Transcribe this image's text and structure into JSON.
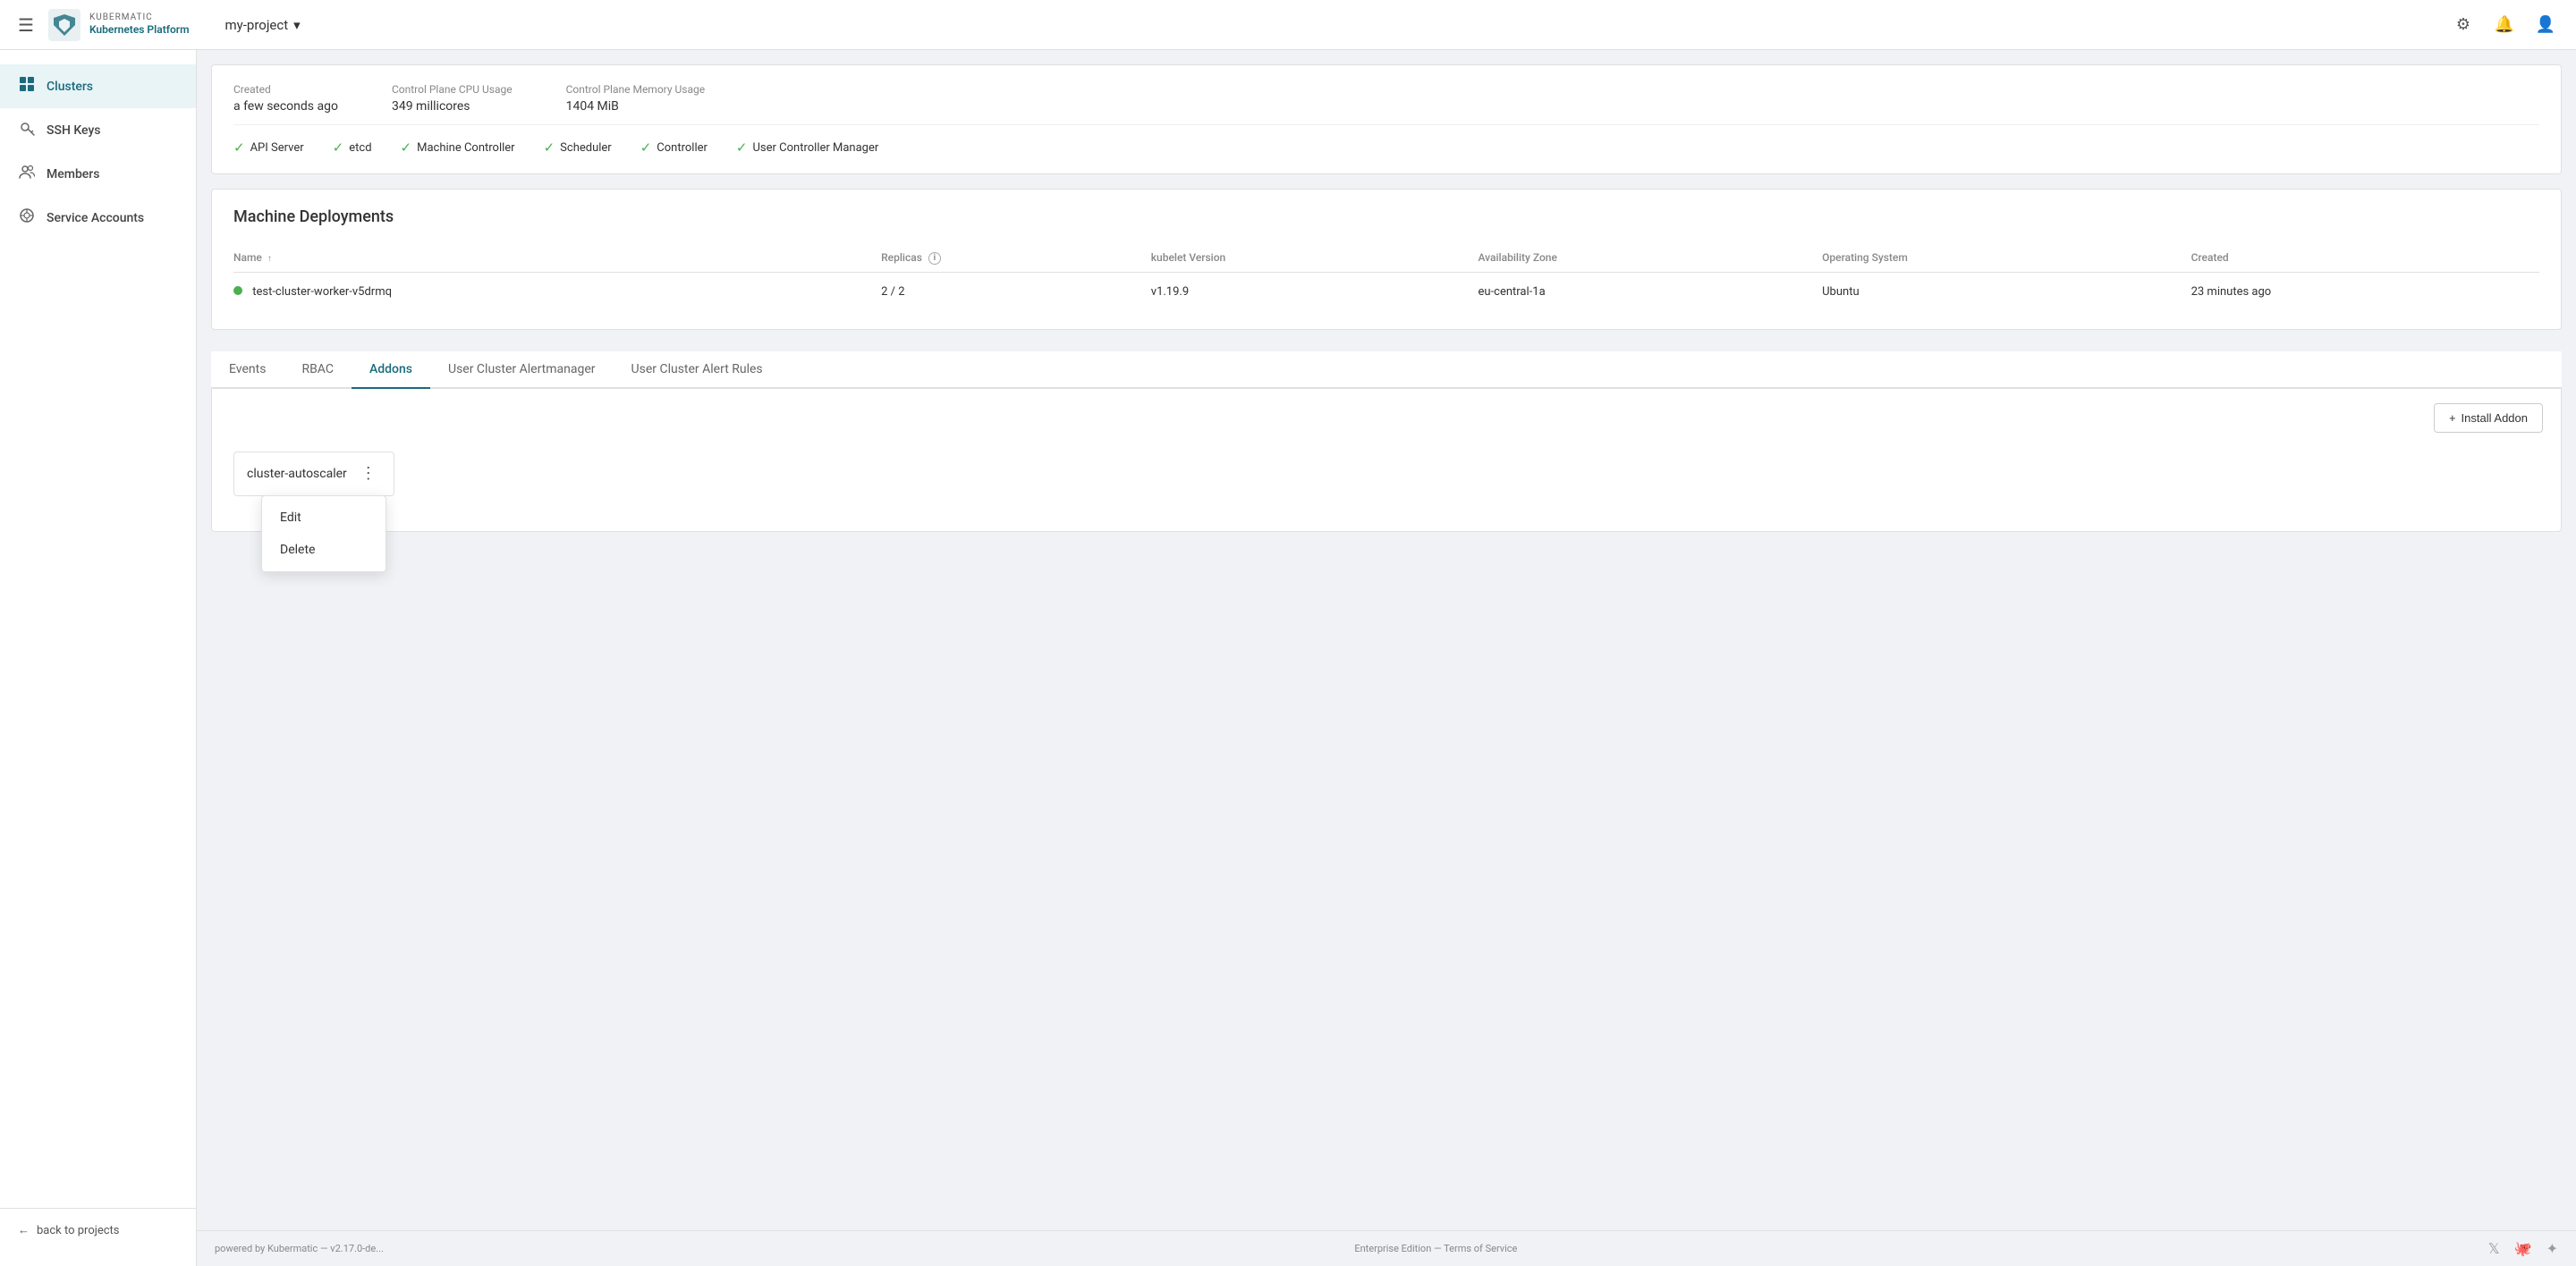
{
  "header": {
    "hamburger_label": "☰",
    "brand": "KUBERMATIC",
    "product": "Kubernetes Platform",
    "project": "my-project",
    "chevron": "▾",
    "icons": {
      "settings": "⚙",
      "notifications": "🔔",
      "user": "👤"
    }
  },
  "sidebar": {
    "items": [
      {
        "id": "clusters",
        "label": "Clusters",
        "icon": "⊞",
        "active": true
      },
      {
        "id": "ssh-keys",
        "label": "SSH Keys",
        "icon": "🔑",
        "active": false
      },
      {
        "id": "members",
        "label": "Members",
        "icon": "👥",
        "active": false
      },
      {
        "id": "service-accounts",
        "label": "Service Accounts",
        "icon": "⚙",
        "active": false
      }
    ],
    "back_label": "back to projects",
    "back_icon": "←"
  },
  "info_card": {
    "created_label": "Created",
    "created_value": "a few seconds ago",
    "cpu_label": "Control Plane CPU Usage",
    "cpu_value": "349 millicores",
    "memory_label": "Control Plane Memory Usage",
    "memory_value": "1404 MiB",
    "status_items": [
      {
        "label": "API Server",
        "icon": "✓"
      },
      {
        "label": "etcd",
        "icon": "✓"
      },
      {
        "label": "Machine Controller",
        "icon": "✓"
      },
      {
        "label": "Scheduler",
        "icon": "✓"
      },
      {
        "label": "Controller",
        "icon": "✓"
      },
      {
        "label": "User Controller Manager",
        "icon": "✓"
      }
    ]
  },
  "machine_deployments": {
    "title": "Machine Deployments",
    "columns": [
      {
        "id": "name",
        "label": "Name",
        "sort": "↑"
      },
      {
        "id": "replicas",
        "label": "Replicas",
        "info": true
      },
      {
        "id": "kubelet",
        "label": "kubelet Version"
      },
      {
        "id": "zone",
        "label": "Availability Zone"
      },
      {
        "id": "os",
        "label": "Operating System"
      },
      {
        "id": "created",
        "label": "Created"
      }
    ],
    "rows": [
      {
        "name": "test-cluster-worker-v5drmq",
        "replicas": "2 / 2",
        "kubelet": "v1.19.9",
        "zone": "eu-central-1a",
        "os": "Ubuntu",
        "created": "23 minutes ago",
        "status": "green"
      }
    ]
  },
  "tabs": {
    "items": [
      {
        "id": "events",
        "label": "Events",
        "active": false
      },
      {
        "id": "rbac",
        "label": "RBAC",
        "active": false
      },
      {
        "id": "addons",
        "label": "Addons",
        "active": true
      },
      {
        "id": "alertmanager",
        "label": "User Cluster Alertmanager",
        "active": false
      },
      {
        "id": "alert-rules",
        "label": "User Cluster Alert Rules",
        "active": false
      }
    ]
  },
  "addons_panel": {
    "install_btn_icon": "+",
    "install_btn_label": "Install Addon",
    "addon": {
      "name": "cluster-autoscaler",
      "dots": "⋮"
    },
    "dropdown": {
      "items": [
        {
          "id": "edit",
          "label": "Edit"
        },
        {
          "id": "delete",
          "label": "Delete"
        }
      ]
    }
  },
  "footer": {
    "powered_text": "powered by Kubermatic — v2.17.0-de...",
    "enterprise_text": "Enterprise Edition — Terms of Service",
    "social": {
      "twitter": "𝕏",
      "github": "🐙",
      "slack": "✦"
    }
  }
}
